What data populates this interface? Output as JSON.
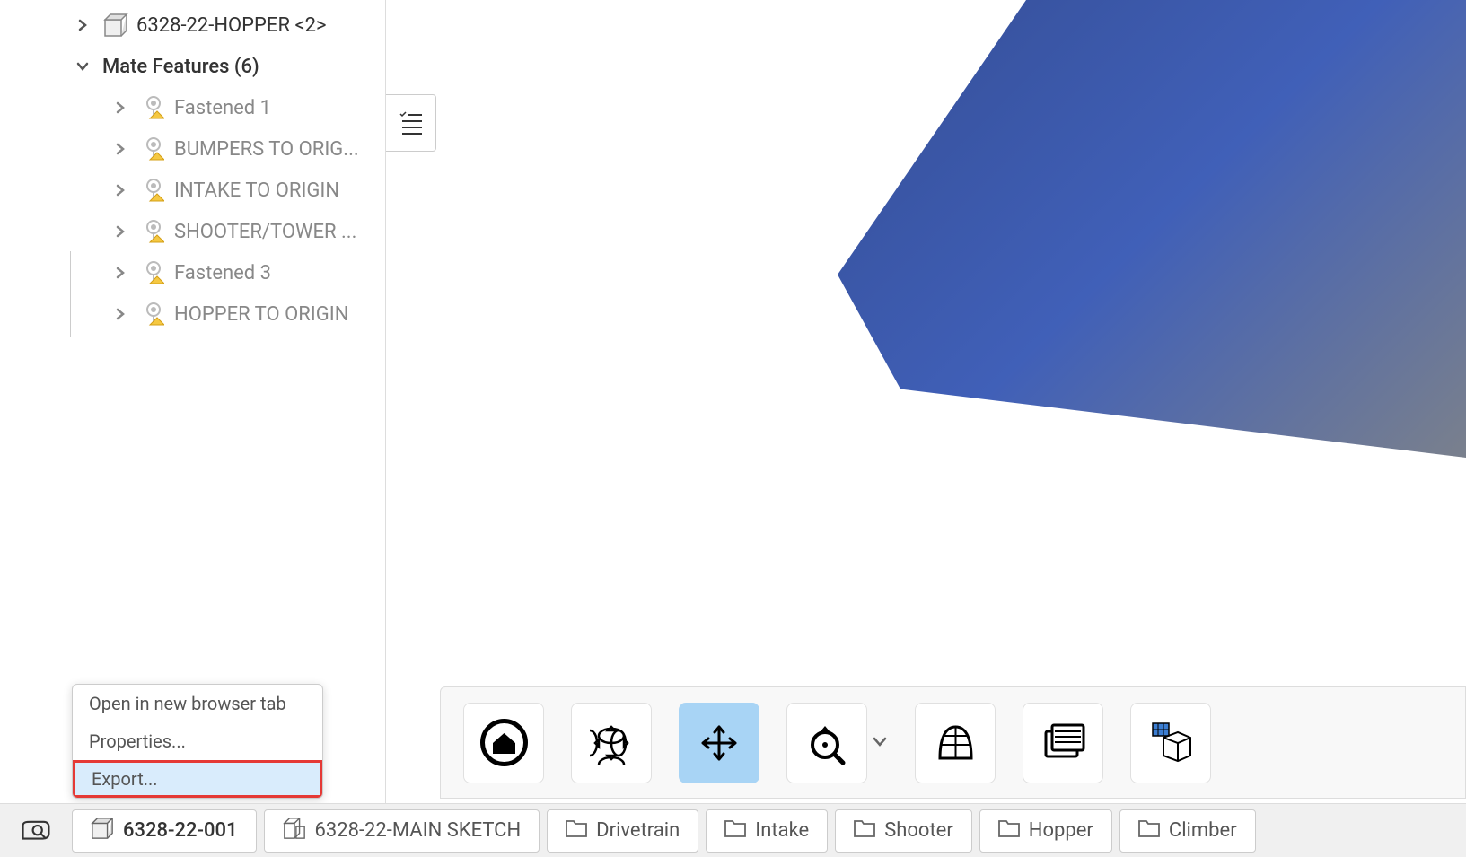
{
  "tree": {
    "item1": {
      "label": "6328-22-HOPPER <2>"
    },
    "folder": {
      "label": "Mate Features (6)",
      "children": [
        {
          "label": "Fastened 1"
        },
        {
          "label": "BUMPERS TO ORIG..."
        },
        {
          "label": "INTAKE TO ORIGIN"
        },
        {
          "label": "SHOOTER/TOWER ..."
        },
        {
          "label": "Fastened 3"
        },
        {
          "label": "HOPPER TO ORIGIN"
        }
      ]
    }
  },
  "context_menu": {
    "items": [
      {
        "label": "Open in new browser tab"
      },
      {
        "label": "Properties..."
      },
      {
        "label": "Export..."
      }
    ],
    "highlighted_index": 2
  },
  "tabs": [
    {
      "label": "6328-22-001",
      "icon": "assembly",
      "active": true
    },
    {
      "label": "6328-22-MAIN SKETCH",
      "icon": "part",
      "active": false
    },
    {
      "label": "Drivetrain",
      "icon": "folder",
      "active": false
    },
    {
      "label": "Intake",
      "icon": "folder",
      "active": false
    },
    {
      "label": "Shooter",
      "icon": "folder",
      "active": false
    },
    {
      "label": "Hopper",
      "icon": "folder",
      "active": false
    },
    {
      "label": "Climber",
      "icon": "folder",
      "active": false
    }
  ],
  "toolbar": {
    "buttons": [
      {
        "name": "home"
      },
      {
        "name": "rotate"
      },
      {
        "name": "pan",
        "active": true
      },
      {
        "name": "zoom",
        "has_dropdown": true
      },
      {
        "name": "section"
      },
      {
        "name": "display-style"
      },
      {
        "name": "iso-view"
      }
    ]
  }
}
